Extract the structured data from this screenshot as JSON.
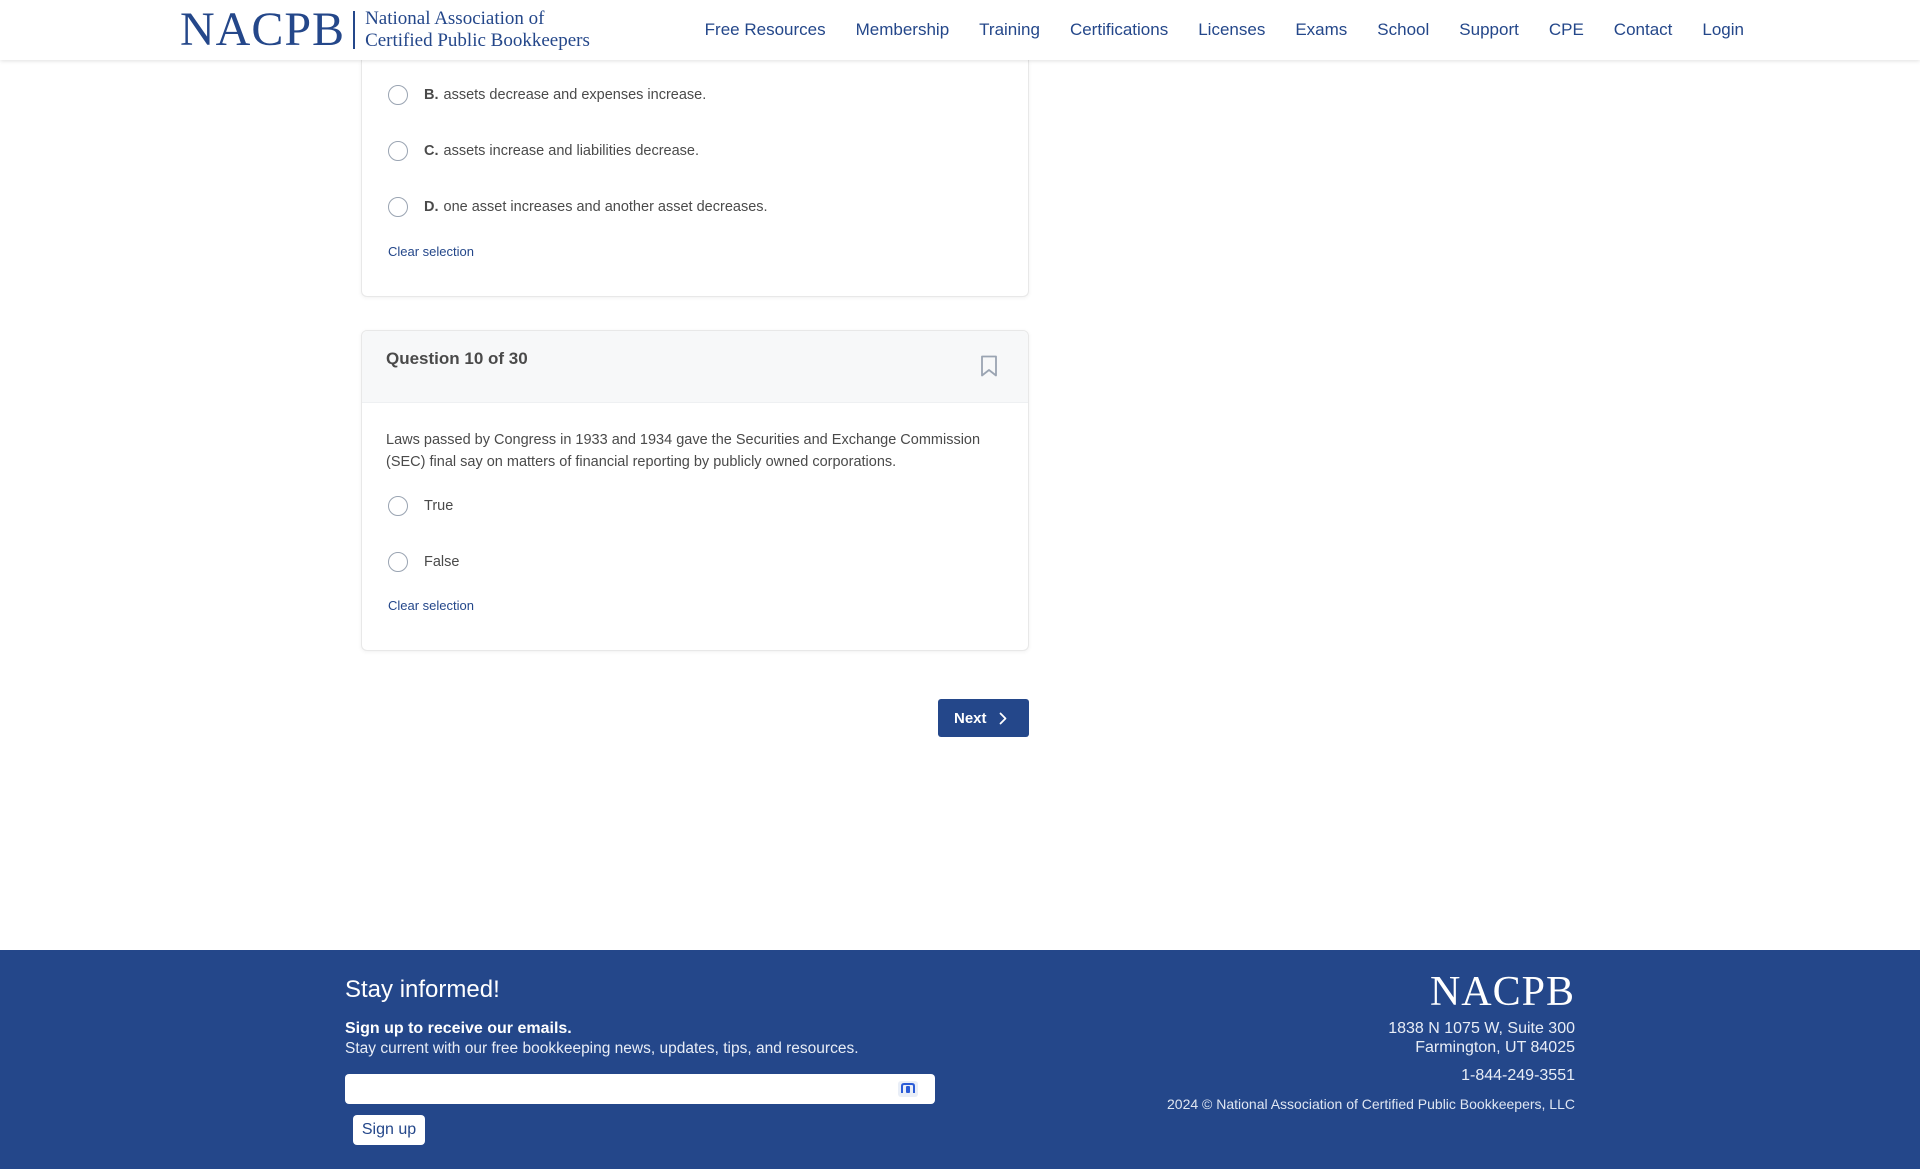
{
  "header": {
    "logo_main": "NACPB",
    "logo_sub_line1": "National Association of",
    "logo_sub_line2": "Certified Public Bookkeepers",
    "nav": [
      "Free Resources",
      "Membership",
      "Training",
      "Certifications",
      "Licenses",
      "Exams",
      "School",
      "Support",
      "CPE",
      "Contact",
      "Login"
    ]
  },
  "previous_question": {
    "options": [
      {
        "letter": "B.",
        "text": "assets decrease and expenses increase."
      },
      {
        "letter": "C.",
        "text": "assets increase and liabilities decrease."
      },
      {
        "letter": "D.",
        "text": "one asset increases and another asset decreases."
      }
    ],
    "clear_label": "Clear selection"
  },
  "question": {
    "title": "Question 10 of 30",
    "text": "Laws passed by Congress in 1933 and 1934 gave the Securities and Exchange Commission (SEC) final say on matters of financial reporting by publicly owned corporations.",
    "options": [
      "True",
      "False"
    ],
    "clear_label": "Clear selection",
    "bookmark_icon": "bookmark-icon"
  },
  "next_label": "Next",
  "footer": {
    "title": "Stay informed!",
    "signup_heading": "Sign up to receive our emails.",
    "signup_desc": "Stay current with our free bookkeeping news, updates, tips, and resources.",
    "email_value": "",
    "signup_button": "Sign up",
    "logo": "NACPB",
    "address_line1": "1838 N 1075 W, Suite 300",
    "address_line2": "Farmington, UT 84025",
    "phone": "1-844-249-3551",
    "copyright": "2024 © National Association of Certified Public Bookkeepers, LLC"
  },
  "colors": {
    "brand": "#24478a",
    "background": "#ffffff",
    "card_header": "#f7f8f9"
  }
}
